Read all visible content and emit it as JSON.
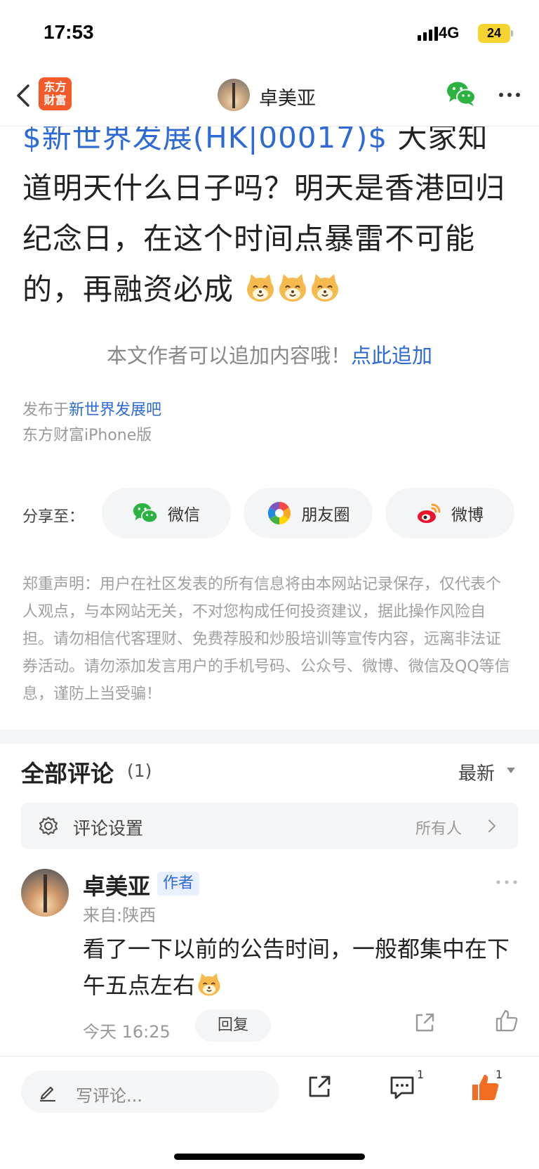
{
  "status_bar": {
    "time": "17:53",
    "network": "4G",
    "battery": "24"
  },
  "nav": {
    "logo_line1": "东方",
    "logo_line2": "财富",
    "title": "卓美亚"
  },
  "post": {
    "stock_tag": "$新世界发展(HK|00017)$",
    "text": "大家知道明天什么日子吗？明天是香港回归纪念日，在这个时间点暴雷不可能的，再融资必成",
    "append_tip": "本文作者可以追加内容哦！",
    "append_link": "点此追加",
    "published_prefix": "发布于",
    "forum": "新世界发展吧",
    "client": "东方财富iPhone版"
  },
  "share": {
    "label": "分享至：",
    "wechat": "微信",
    "moments": "朋友圈",
    "weibo": "微博"
  },
  "disclaimer": "郑重声明：用户在社区发表的所有信息将由本网站记录保存，仅代表个人观点，与本网站无关，不对您构成任何投资建议，据此操作风险自担。请勿相信代客理财、免费荐股和炒股培训等宣传内容，远离非法证券活动。请勿添加发言用户的手机号码、公众号、微博、微信及QQ等信息，谨防上当受骗！",
  "comments": {
    "title": "全部评论",
    "count": "(1)",
    "sort": "最新",
    "settings_label": "评论设置",
    "settings_value": "所有人",
    "items": [
      {
        "author": "卓美亚",
        "badge": "作者",
        "location": "来自:陕西",
        "text": "看了一下以前的公告时间，一般都集中在下午五点左右",
        "time": "今天 16:25",
        "reply_label": "回复"
      }
    ]
  },
  "bottom_bar": {
    "input_placeholder": "写评论...",
    "comment_count": "1",
    "like_count": "1"
  },
  "colors": {
    "link": "#2e6ad6",
    "like": "#f36c21",
    "logo": "#f25a29",
    "wechat": "#2bb240"
  }
}
